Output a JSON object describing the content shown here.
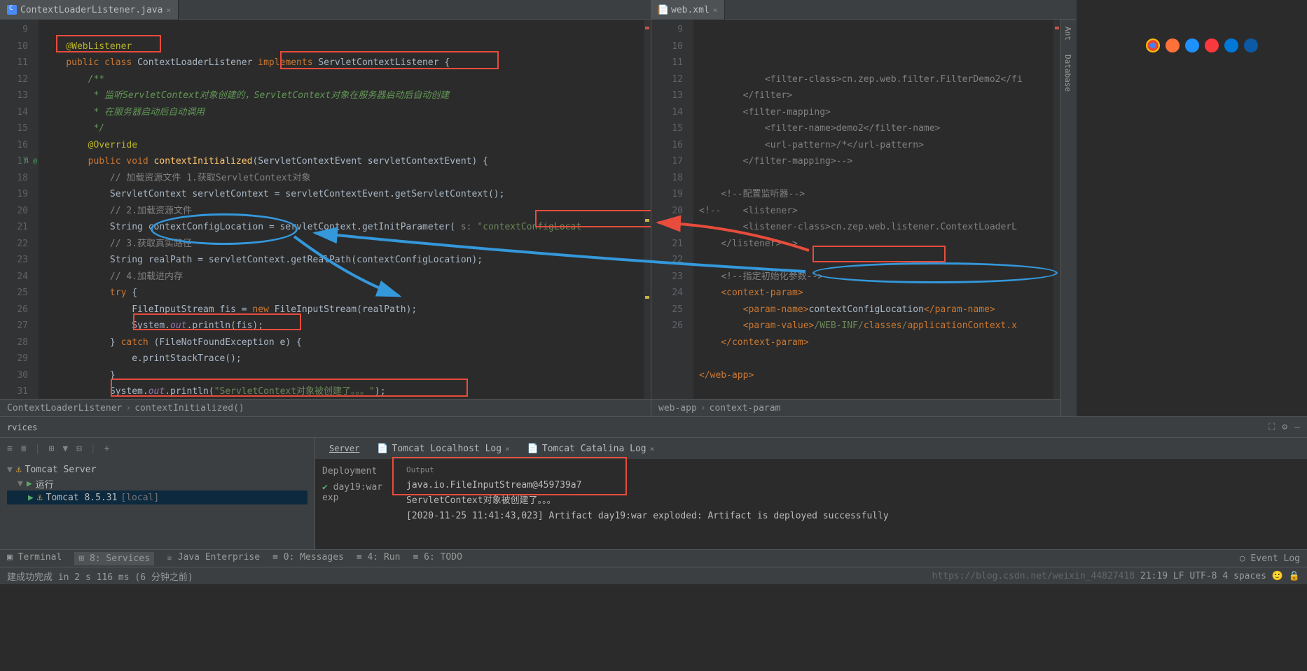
{
  "leftTab": {
    "name": "ContextLoaderListener.java"
  },
  "rightTab": {
    "name": "web.xml"
  },
  "leftCode": {
    "lines": [
      {
        "n": 9,
        "html": ""
      },
      {
        "n": 10,
        "html": "    <span class='ann'>@WebListener</span>"
      },
      {
        "n": 11,
        "html": "    <span class='kw'>public class </span>ContextLoaderListener <span class='kw'>implements </span>ServletContextListener {"
      },
      {
        "n": 12,
        "html": "        <span class='docc'>/**</span>"
      },
      {
        "n": 13,
        "html": "<span class='docc'>         * 监听ServletContext对象创建的，ServletContext对象在服务器启动后自动创建</span>"
      },
      {
        "n": 14,
        "html": "<span class='docc'>         * 在服务器启动后自动调用</span>"
      },
      {
        "n": 15,
        "html": "<span class='docc'>         */</span>"
      },
      {
        "n": 16,
        "html": "        <span class='ann'>@Override</span>"
      },
      {
        "n": 17,
        "html": "        <span class='kw'>public void </span><span style='color:#ffc66d'>contextInitialized</span>(ServletContextEvent servletContextEvent) {"
      },
      {
        "n": 18,
        "html": "            <span class='com'>// 加载资源文件 1.获取ServletContext对象</span>"
      },
      {
        "n": 19,
        "html": "            ServletContext servletContext = servletContextEvent.getServletContext();"
      },
      {
        "n": 20,
        "html": "            <span class='com'>// 2.加载资源文件</span>"
      },
      {
        "n": 21,
        "html": "            String contextConfigLocation = servletContext.getInitParameter( <span class='com'>s:</span> <span class='str'>\"contextConfigLocat</span>"
      },
      {
        "n": 22,
        "html": "            <span class='com'>// 3.获取真实路径</span>"
      },
      {
        "n": 23,
        "html": "            String realPath = servletContext.getRealPath(contextConfigLocation);"
      },
      {
        "n": 24,
        "html": "            <span class='com'>// 4.加载进内存</span>"
      },
      {
        "n": 25,
        "html": "            <span class='kw'>try </span>{"
      },
      {
        "n": 26,
        "html": "                FileInputStream fis = <span class='kw'>new </span>FileInputStream(realPath);"
      },
      {
        "n": 27,
        "html": "                System.<span class='fld'>out</span>.println(fis);"
      },
      {
        "n": 28,
        "html": "            } <span class='kw'>catch </span>(FileNotFoundException e) {"
      },
      {
        "n": 29,
        "html": "                e.printStackTrace();"
      },
      {
        "n": 30,
        "html": "            }"
      },
      {
        "n": 31,
        "html": "            System.<span class='fld'>out</span>.println(<span class='str'>\"ServletContext对象被创建了。。。\"</span>);"
      }
    ]
  },
  "rightCode": {
    "lines": [
      {
        "n": 9,
        "html": "            <span class='com'>&lt;filter-class&gt;cn.zep.web.filter.FilterDemo2&lt;/fi</span>"
      },
      {
        "n": 10,
        "html": "        <span class='com'>&lt;/filter&gt;</span>"
      },
      {
        "n": 11,
        "html": "        <span class='com'>&lt;filter-mapping&gt;</span>"
      },
      {
        "n": 12,
        "html": "            <span class='com'>&lt;filter-name&gt;demo2&lt;/filter-name&gt;</span>"
      },
      {
        "n": 13,
        "html": "            <span class='com'>&lt;url-pattern&gt;/*&lt;/url-pattern&gt;</span>"
      },
      {
        "n": 14,
        "html": "        <span class='com'>&lt;/filter-mapping&gt;--&gt;</span>"
      },
      {
        "n": 15,
        "html": ""
      },
      {
        "n": 16,
        "html": "    <span class='com'>&lt;!--配置监听器--&gt;</span>"
      },
      {
        "n": 17,
        "html": "<span class='com'>&lt;!--    &lt;listener&gt;</span>"
      },
      {
        "n": 18,
        "html": "        <span class='com'>&lt;listener-class&gt;cn.zep.web.listener.ContextLoaderL</span>"
      },
      {
        "n": 19,
        "html": "    <span class='com'>&lt;/listener&gt;--&gt;</span>"
      },
      {
        "n": 20,
        "html": ""
      },
      {
        "n": "",
        "html": "    <span class='com'>&lt;!--指定初始化参数--&gt;</span>"
      },
      {
        "n": 21,
        "html": "    <span class='kw'>&lt;context-param&gt;</span>"
      },
      {
        "n": 22,
        "html": "        <span class='kw'>&lt;param-name&gt;</span>contextConfigLocation<span class='kw'>&lt;/param-name&gt;</span>"
      },
      {
        "n": 23,
        "html": "        <span class='kw'>&lt;param-value&gt;</span><span class='str'>/WEB-INF/</span><span style='color:#cc7832'>classes</span><span class='str'>/</span><span style='color:#cc7832'>applicationContext.x</span>"
      },
      {
        "n": 24,
        "html": "    <span class='kw'>&lt;/context-param&gt;</span>"
      },
      {
        "n": 25,
        "html": ""
      },
      {
        "n": 26,
        "html": "<span class='kw'>&lt;/web-app&gt;</span>"
      }
    ]
  },
  "leftBreadcrumb": [
    "ContextLoaderListener",
    "contextInitialized()"
  ],
  "rightBreadcrumb": [
    "web-app",
    "context-param"
  ],
  "servicesTitle": "rvices",
  "svTree": {
    "root": "Tomcat Server",
    "run": "运行",
    "tomcat": "Tomcat 8.5.31",
    "local": "[local]"
  },
  "svTabs": {
    "server": "Server",
    "t1": "Tomcat Localhost Log",
    "t2": "Tomcat Catalina Log"
  },
  "deployment": {
    "label": "Deployment",
    "item": "day19:war exp"
  },
  "output": {
    "label": "Output",
    "l1": "java.io.FileInputStream@459739a7",
    "l2": "ServletContext对象被创建了。。。",
    "l3": "[2020-11-25 11:41:43,023] Artifact day19:war exploded: Artifact is deployed successfully"
  },
  "bottomBar": {
    "terminal": "Terminal",
    "services": "8: Services",
    "je": "Java Enterprise",
    "msg": "0: Messages",
    "run": "4: Run",
    "todo": "6: TODO",
    "evlog": "Event Log"
  },
  "statusBar": {
    "left": "建成功完成 in 2 s 116 ms (6 分钟之前)",
    "caret": "21:19",
    "enc": "",
    "sep": "LF",
    "spaces": "4 spaces"
  },
  "watermark": "https://blog.csdn.net/weixin_44827418",
  "rightSidebar": {
    "ant": "Ant",
    "db": "Database"
  }
}
